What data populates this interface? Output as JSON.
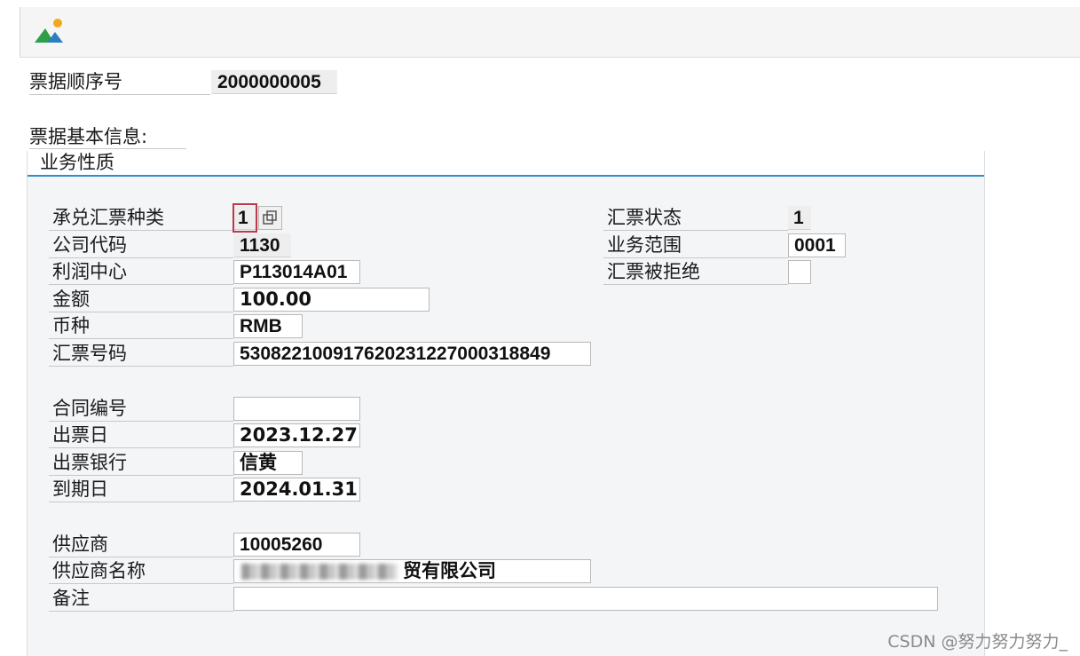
{
  "header": {
    "seq_label": "票据顺序号",
    "seq_value": "2000000005",
    "section_label": "票据基本信息:"
  },
  "panel": {
    "title": "业务性质",
    "left_fields": [
      {
        "label": "承兑汇票种类",
        "value": "1"
      },
      {
        "label": "公司代码",
        "value": "1130"
      },
      {
        "label": "利润中心",
        "value": "P113014A01"
      },
      {
        "label": "金额",
        "value": "100.00"
      },
      {
        "label": "币种",
        "value": "RMB"
      },
      {
        "label": "汇票号码",
        "value": "530822100917620231227000318849"
      },
      {
        "label": "合同编号",
        "value": ""
      },
      {
        "label": "出票日",
        "value": "2023.12.27"
      },
      {
        "label": "出票银行",
        "value": "信黄"
      },
      {
        "label": "到期日",
        "value": "2024.01.31"
      },
      {
        "label": "供应商",
        "value": "10005260"
      },
      {
        "label": "供应商名称",
        "value": "贸有限公司"
      },
      {
        "label": "备注",
        "value": ""
      }
    ],
    "right_fields": [
      {
        "label": "汇票状态",
        "value": "1"
      },
      {
        "label": "业务范围",
        "value": "0001"
      },
      {
        "label": "汇票被拒绝",
        "value": ""
      }
    ]
  },
  "watermark": "CSDN @努力努力努力_",
  "colors": {
    "accent": "#2f8dc9",
    "required": "#b83a4b",
    "logo_green": "#2e9e48",
    "logo_blue": "#2b7fc1",
    "logo_orange": "#f2a81d"
  },
  "icons": {
    "app": "mountain-sun-icon",
    "f4_help": "value-help-icon"
  }
}
